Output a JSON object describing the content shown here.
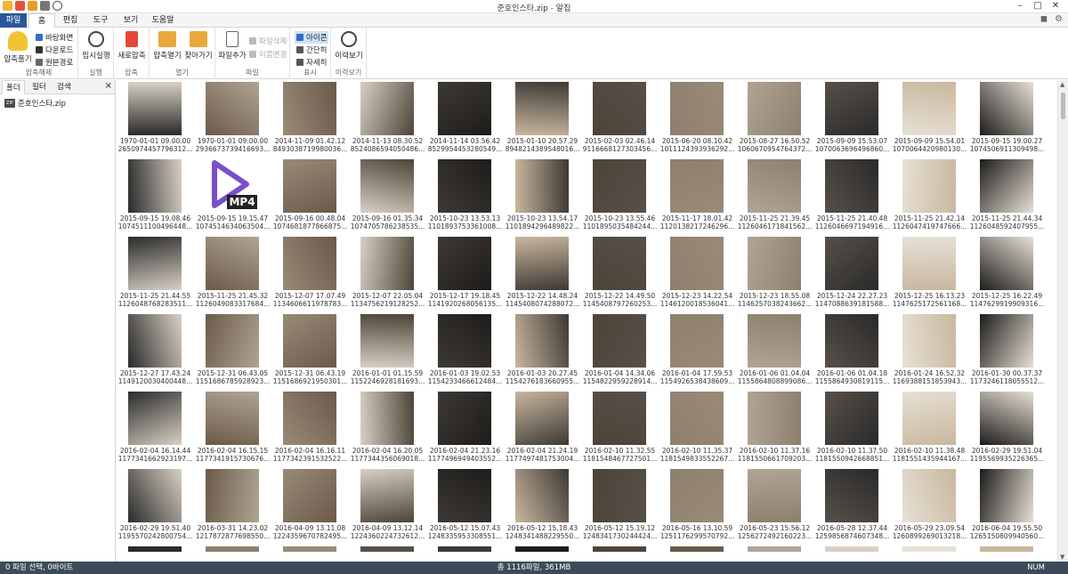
{
  "window": {
    "title": "준호인스타.zip - 알집"
  },
  "menu": [
    "파일",
    "홈",
    "편집",
    "도구",
    "보기",
    "도움말"
  ],
  "ribbon": {
    "g1": {
      "label": "압축해제",
      "btn": "압축풀기",
      "items": [
        "바탕화면",
        "다운로드",
        "원본경로"
      ]
    },
    "g2": {
      "label": "실행",
      "btn": "임시실행"
    },
    "g3": {
      "label": "압축",
      "btn": "새로압축"
    },
    "g4": {
      "label": "열기",
      "btn1": "압축열기",
      "btn2": "찾아가기"
    },
    "g5": {
      "label": "파일",
      "btn": "파일추가",
      "items": [
        "파일삭제",
        "이름변경"
      ]
    },
    "g6": {
      "label": "표시",
      "items": [
        "아이콘",
        "간단히",
        "자세히"
      ]
    },
    "g7": {
      "label": "이력보기",
      "btn": "이력보기"
    }
  },
  "leftpane": {
    "tabs": [
      "폴더",
      "필터",
      "검색"
    ],
    "close": "×",
    "tree_item": "준호인스타.zip",
    "zip_badge": "ZIP"
  },
  "statusbar": {
    "left": "0 파일 선택, 0바이트",
    "center": "총 1116파일, 361MB",
    "right": "NUM"
  },
  "files": [
    {
      "d": "1970-01-01 09.00.00",
      "id": "2650974457796312..."
    },
    {
      "d": "1970-01-01 09.00.00",
      "id": "2936673739416693..."
    },
    {
      "d": "2014-11-09 01.42.12",
      "id": "8493038719980036..."
    },
    {
      "d": "2014-11-13 08.30.52",
      "id": "8524086594050486..."
    },
    {
      "d": "2014-11-14 03.56.42",
      "id": "8529954453280549..."
    },
    {
      "d": "2015-01-10 20.57.29",
      "id": "8948214389548016..."
    },
    {
      "d": "2015-02-03 02.46.14",
      "id": "9116668127303456..."
    },
    {
      "d": "2015-06-20 08.10.42",
      "id": "1011124393936292..."
    },
    {
      "d": "2015-08-27 16.50.52",
      "id": "1060670954764372..."
    },
    {
      "d": "2015-09-09 15.53.07",
      "id": "1070063696496860..."
    },
    {
      "d": "2015-09-09 15.54.01",
      "id": "1070064420980130..."
    },
    {
      "d": "2015-09-15 19.00.27",
      "id": "1074506911309498..."
    },
    {
      "d": "2015-09-15 19.08.46",
      "id": "1074511100496448..."
    },
    {
      "d": "2015-09-15 19.15.47",
      "id": "1074514634063504...",
      "mp4": "MP4"
    },
    {
      "d": "2015-09-16 00.48.04",
      "id": "1074681877866875..."
    },
    {
      "d": "2015-09-16 01.35.34",
      "id": "1074705786238535..."
    },
    {
      "d": "2015-10-23 13.53.13",
      "id": "1101893753361008..."
    },
    {
      "d": "2015-10-23 13.54.17",
      "id": "1101894296489822..."
    },
    {
      "d": "2015-10-23 13.55.46",
      "id": "1101895035484244..."
    },
    {
      "d": "2015-11-17 18.01.42",
      "id": "1120138217246296..."
    },
    {
      "d": "2015-11-25 21.39.45",
      "id": "1126046171841562..."
    },
    {
      "d": "2015-11-25 21.40.48",
      "id": "1126046697194916..."
    },
    {
      "d": "2015-11-25 21.42.14",
      "id": "1126047419747666..."
    },
    {
      "d": "2015-11-25 21.44.34",
      "id": "1126048592407955..."
    },
    {
      "d": "2015-11-25 21.44.55",
      "id": "1126048768283511..."
    },
    {
      "d": "2015-11-25 21.45.32",
      "id": "1126049083317684..."
    },
    {
      "d": "2015-12-07 17.07.49",
      "id": "1134606611978783..."
    },
    {
      "d": "2015-12-07 22.05.04",
      "id": "1134756219128252..."
    },
    {
      "d": "2015-12-17 19.18.45",
      "id": "1141920268056135..."
    },
    {
      "d": "2015-12-22 14.48.24",
      "id": "1145408074288072..."
    },
    {
      "d": "2015-12-22 14.49.50",
      "id": "1145408797260253..."
    },
    {
      "d": "2015-12-23 14.22.54",
      "id": "1146120018536041..."
    },
    {
      "d": "2015-12-23 18.55.08",
      "id": "1146257038243662..."
    },
    {
      "d": "2015-12-24 22.27.23",
      "id": "1147088639181588..."
    },
    {
      "d": "2015-12-25 16.13.23",
      "id": "1147625172561168..."
    },
    {
      "d": "2015-12-25 16.22.49",
      "id": "1147629919909316..."
    },
    {
      "d": "2015-12-27 17.43.24",
      "id": "1149120030400448..."
    },
    {
      "d": "2015-12-31 06.43.05",
      "id": "1151686785928923..."
    },
    {
      "d": "2015-12-31 06.43.19",
      "id": "1151686921950301..."
    },
    {
      "d": "2016-01-01 01.15.59",
      "id": "1152246928181693..."
    },
    {
      "d": "2016-01-03 19.02.53",
      "id": "1154233466612484..."
    },
    {
      "d": "2016-01-03 20.27.45",
      "id": "1154276183660955..."
    },
    {
      "d": "2016-01-04 14.34.06",
      "id": "1154822959228914..."
    },
    {
      "d": "2016-01-04 17.59.53",
      "id": "1154926538438609..."
    },
    {
      "d": "2016-01-06 01.04.04",
      "id": "1155864808899086..."
    },
    {
      "d": "2016-01-06 01.04.18",
      "id": "1155864930819115..."
    },
    {
      "d": "2016-01-24 16.52.32",
      "id": "1169388151853943..."
    },
    {
      "d": "2016-01-30 00.37.37",
      "id": "1173246118055512..."
    },
    {
      "d": "2016-02-04 16.14.44",
      "id": "1177341662923197..."
    },
    {
      "d": "2016-02-04 16.15.15",
      "id": "1177341915730676..."
    },
    {
      "d": "2016-02-04 16.16.11",
      "id": "1177342391532522..."
    },
    {
      "d": "2016-02-04 16.20.05",
      "id": "1177344356069018..."
    },
    {
      "d": "2016-02-04 21.23.16",
      "id": "1177496949403552..."
    },
    {
      "d": "2016-02-04 21.24.19",
      "id": "1177497481753004..."
    },
    {
      "d": "2016-02-10 11.32.55",
      "id": "1181548467727501..."
    },
    {
      "d": "2016-02-10 11.35.37",
      "id": "1181549833552267..."
    },
    {
      "d": "2016-02-10 11.37.16",
      "id": "1181550661709203..."
    },
    {
      "d": "2016-02-10 11.37.50",
      "id": "1181550942668851..."
    },
    {
      "d": "2016-02-10 11.38.48",
      "id": "1181551435944167..."
    },
    {
      "d": "2016-02-29 19.51.04",
      "id": "1195569935226365..."
    },
    {
      "d": "2016-02-29 19.51.40",
      "id": "1195570242800754..."
    },
    {
      "d": "2016-03-31 14.23.02",
      "id": "1217872877698550..."
    },
    {
      "d": "2016-04-09 13.11.08",
      "id": "1224359670782495..."
    },
    {
      "d": "2016-04-09 13.12.14",
      "id": "1224360224732612..."
    },
    {
      "d": "2016-05-12 15.07.43",
      "id": "1248335953308551..."
    },
    {
      "d": "2016-05-12 15.18.43",
      "id": "1248341488229550..."
    },
    {
      "d": "2016-05-12 15.19.12",
      "id": "1248341730244424..."
    },
    {
      "d": "2016-05-16 13.10.59",
      "id": "1251176299570792..."
    },
    {
      "d": "2016-05-23 15.56.12",
      "id": "1256272492160223..."
    },
    {
      "d": "2016-05-28 12.37.44",
      "id": "1259856874607348..."
    },
    {
      "d": "2016-05-29 23.09.54",
      "id": "1260899269013218..."
    },
    {
      "d": "2016-06-04 19.55.50",
      "id": "1265150809940560..."
    }
  ]
}
